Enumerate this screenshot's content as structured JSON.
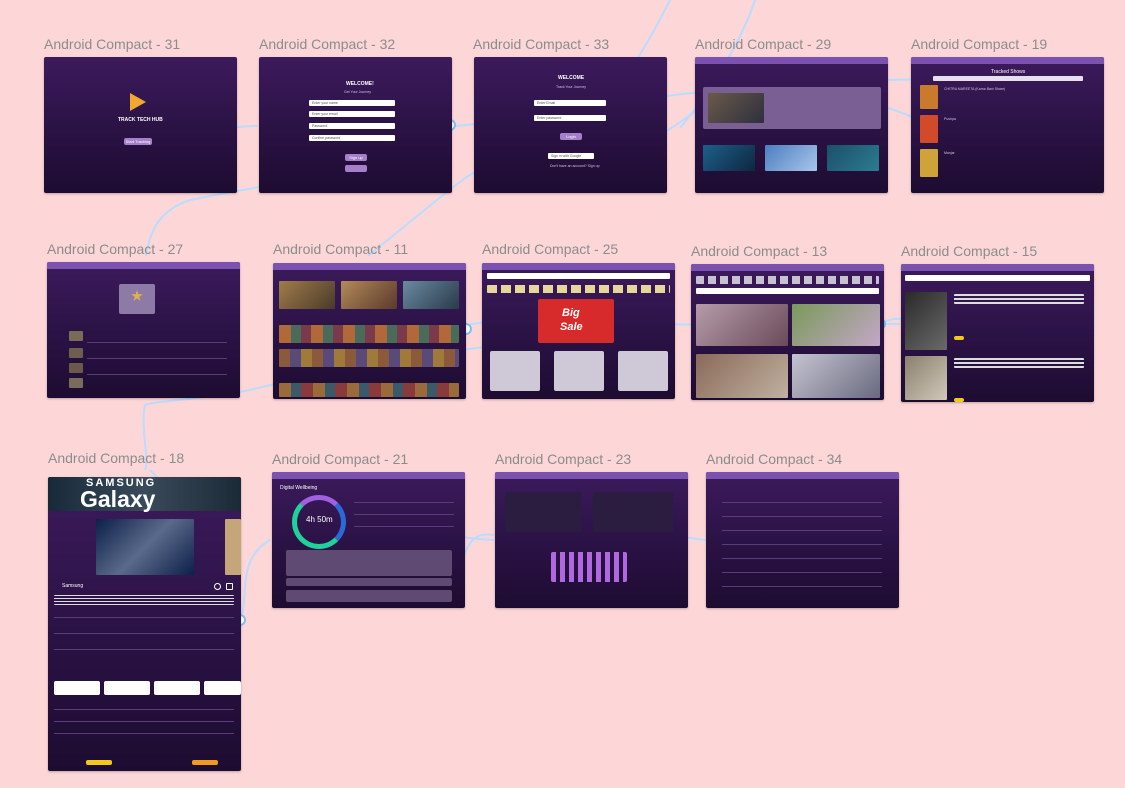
{
  "frames": {
    "f31": "Android Compact - 31",
    "f32": "Android Compact - 32",
    "f33": "Android Compact - 33",
    "f29": "Android Compact - 29",
    "f19": "Android Compact - 19",
    "f27": "Android Compact - 27",
    "f11": "Android Compact - 11",
    "f25": "Android Compact - 25",
    "f13": "Android Compact - 13",
    "f15": "Android Compact - 15",
    "f18": "Android Compact - 18",
    "f21": "Android Compact - 21",
    "f23": "Android Compact - 23",
    "f34": "Android Compact - 34"
  },
  "screens": {
    "splash": {
      "brand": "TRACK TECH HUB",
      "start_button": "Start Tracking"
    },
    "signup": {
      "heading": "WELCOME!",
      "sub": "Get Your Journey",
      "fields": [
        "Enter your name",
        "Enter your email",
        "Password",
        "Confirm password"
      ],
      "submit": "Sign up"
    },
    "login": {
      "heading": "WELCOME",
      "sub": "Track Your Journey",
      "fields": [
        "Enter Email",
        "Enter password"
      ],
      "submit": "Login",
      "google": "Sign in with Google",
      "footer": "Don't have an account? Sign up"
    },
    "tracked": {
      "title": "Tracked Shows",
      "items": [
        "CHITRA MAREETA (Karna Bani Share)",
        "Pushpa",
        "Manjar"
      ]
    },
    "wellbeing": {
      "title": "Digital Wellbeing",
      "time": "4h 50m"
    },
    "product": {
      "banner_top": "SAMSUNG",
      "banner_main": "Galaxy",
      "brand": "Samsung"
    },
    "sale": {
      "line1": "Big",
      "line2": "Sale"
    }
  }
}
